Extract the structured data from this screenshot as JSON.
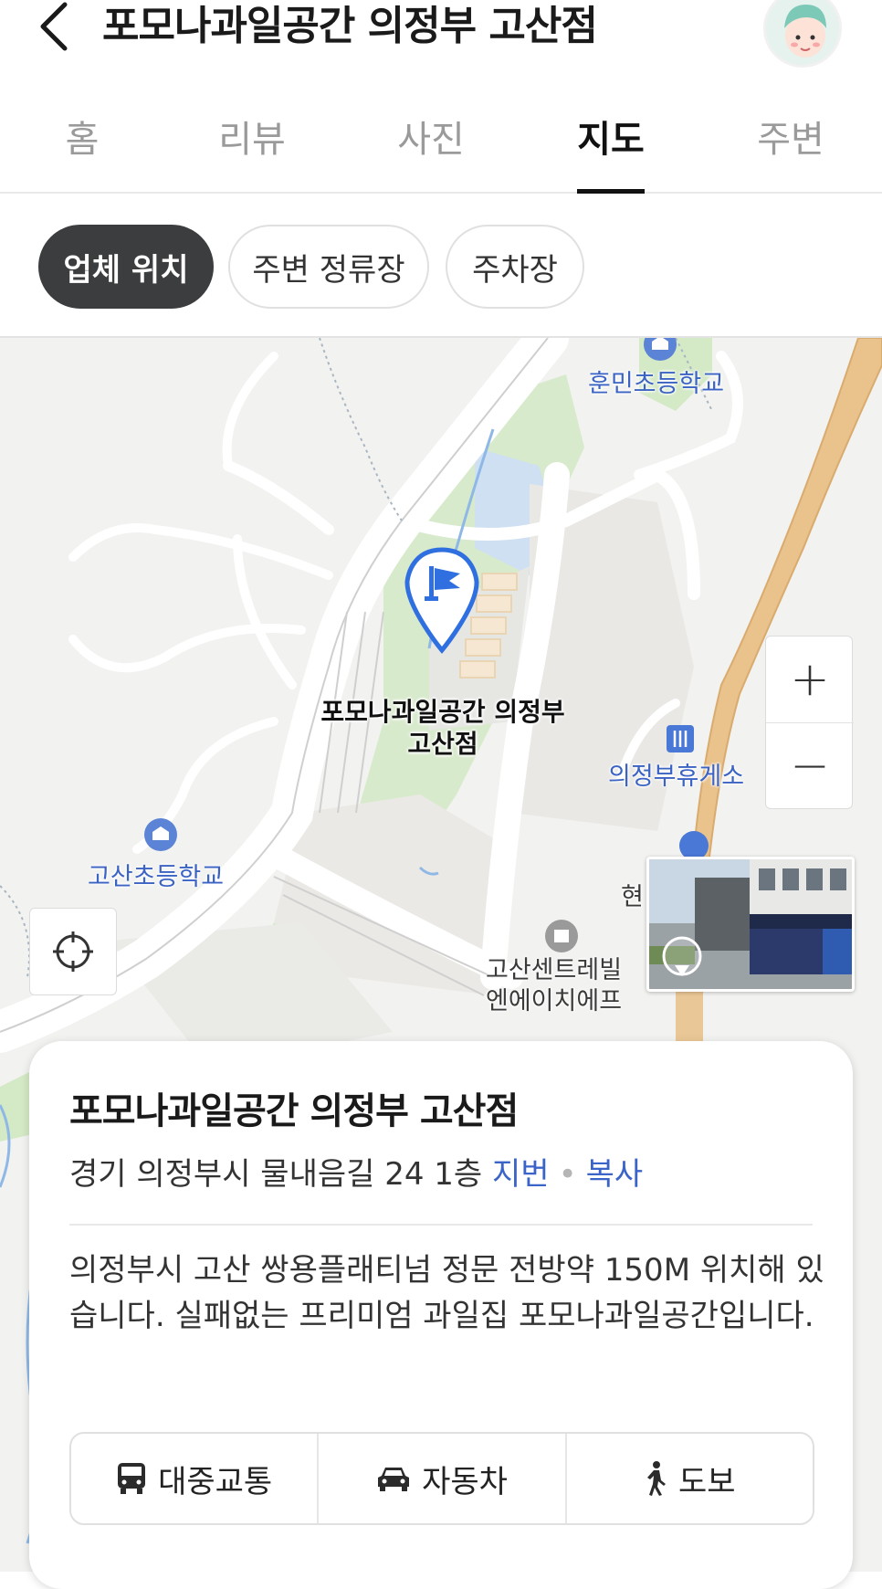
{
  "header": {
    "title": "포모나과일공간 의정부 고산점",
    "back_icon": "chevron-left-icon",
    "avatar_icon": "user-avatar-icon"
  },
  "tabs": [
    {
      "label": "홈",
      "active": false
    },
    {
      "label": "리뷰",
      "active": false
    },
    {
      "label": "사진",
      "active": false
    },
    {
      "label": "지도",
      "active": true
    },
    {
      "label": "주변",
      "active": false
    }
  ],
  "chips": [
    {
      "label": "업체 위치",
      "active": true
    },
    {
      "label": "주변 정류장",
      "active": false
    },
    {
      "label": "주차장",
      "active": false
    }
  ],
  "map": {
    "marker_label": "포모나과일공간 의정부\n고산점",
    "pois": {
      "hunmin": "훈민초등학교",
      "rest_area": "의정부휴게소",
      "gosan_school": "고산초등학교",
      "hyeon": "현",
      "gosan_centrel": "고산센트레빌\n엔에이치에프"
    },
    "zoom_in": "+",
    "zoom_out": "−",
    "icons": {
      "locate": "crosshair-icon",
      "marker": "flag-pin-icon",
      "roadview": "roadview-thumbnail"
    },
    "colors": {
      "marker": "#2f6fe0",
      "highway": "#e8c48d",
      "green": "#d3e9c4",
      "water": "#cfe0f3"
    }
  },
  "card": {
    "name": "포모나과일공간 의정부 고산점",
    "address": "경기 의정부시 물내음길 24 1층",
    "jibun": "지번",
    "separator": "•",
    "copy": "복사",
    "description": "의정부시 고산 쌍용플래티넘 정문 전방약 150M 위치해 있습니다. 실패없는 프리미엄 과일집 포모나과일공간입니다.",
    "routes": [
      {
        "label": "대중교통",
        "icon": "bus-icon"
      },
      {
        "label": "자동차",
        "icon": "car-icon"
      },
      {
        "label": "도보",
        "icon": "walking-icon"
      }
    ]
  }
}
